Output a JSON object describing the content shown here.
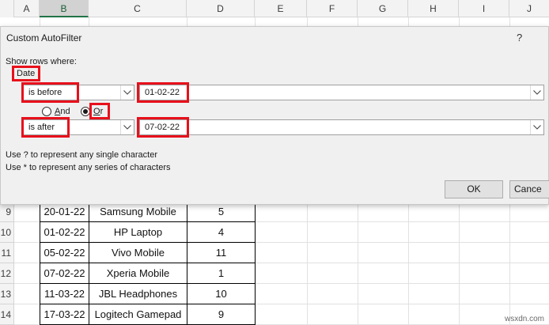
{
  "spreadsheet": {
    "columns": [
      "A",
      "B",
      "C",
      "D",
      "E",
      "F",
      "G",
      "H",
      "I",
      "J"
    ],
    "rows": [
      {
        "num": "9",
        "date": "20-01-22",
        "product": "Samsung Mobile",
        "qty": "5"
      },
      {
        "num": "10",
        "date": "01-02-22",
        "product": "HP Laptop",
        "qty": "4"
      },
      {
        "num": "11",
        "date": "05-02-22",
        "product": "Vivo Mobile",
        "qty": "11"
      },
      {
        "num": "12",
        "date": "07-02-22",
        "product": "Xperia Mobile",
        "qty": "1"
      },
      {
        "num": "13",
        "date": "11-03-22",
        "product": "JBL Headphones",
        "qty": "10"
      },
      {
        "num": "14",
        "date": "17-03-22",
        "product": "Logitech Gamepad",
        "qty": "9"
      }
    ]
  },
  "dialog": {
    "title": "Custom AutoFilter",
    "help": "?",
    "show_rows_label": "Show rows where:",
    "field_name": "Date",
    "condition1": {
      "operator": "is before",
      "value": "01-02-22"
    },
    "condition2": {
      "operator": "is after",
      "value": "07-02-22"
    },
    "logic": {
      "and_label": "And",
      "or_label": "Or",
      "selected": "Or"
    },
    "hint1": "Use ? to represent any single character",
    "hint2": "Use * to represent any series of characters",
    "ok_label": "OK",
    "cancel_label": "Cance"
  },
  "colors": {
    "highlight": "#e8101b",
    "selected_column": "#217346"
  },
  "watermark": "wsxdn.com"
}
